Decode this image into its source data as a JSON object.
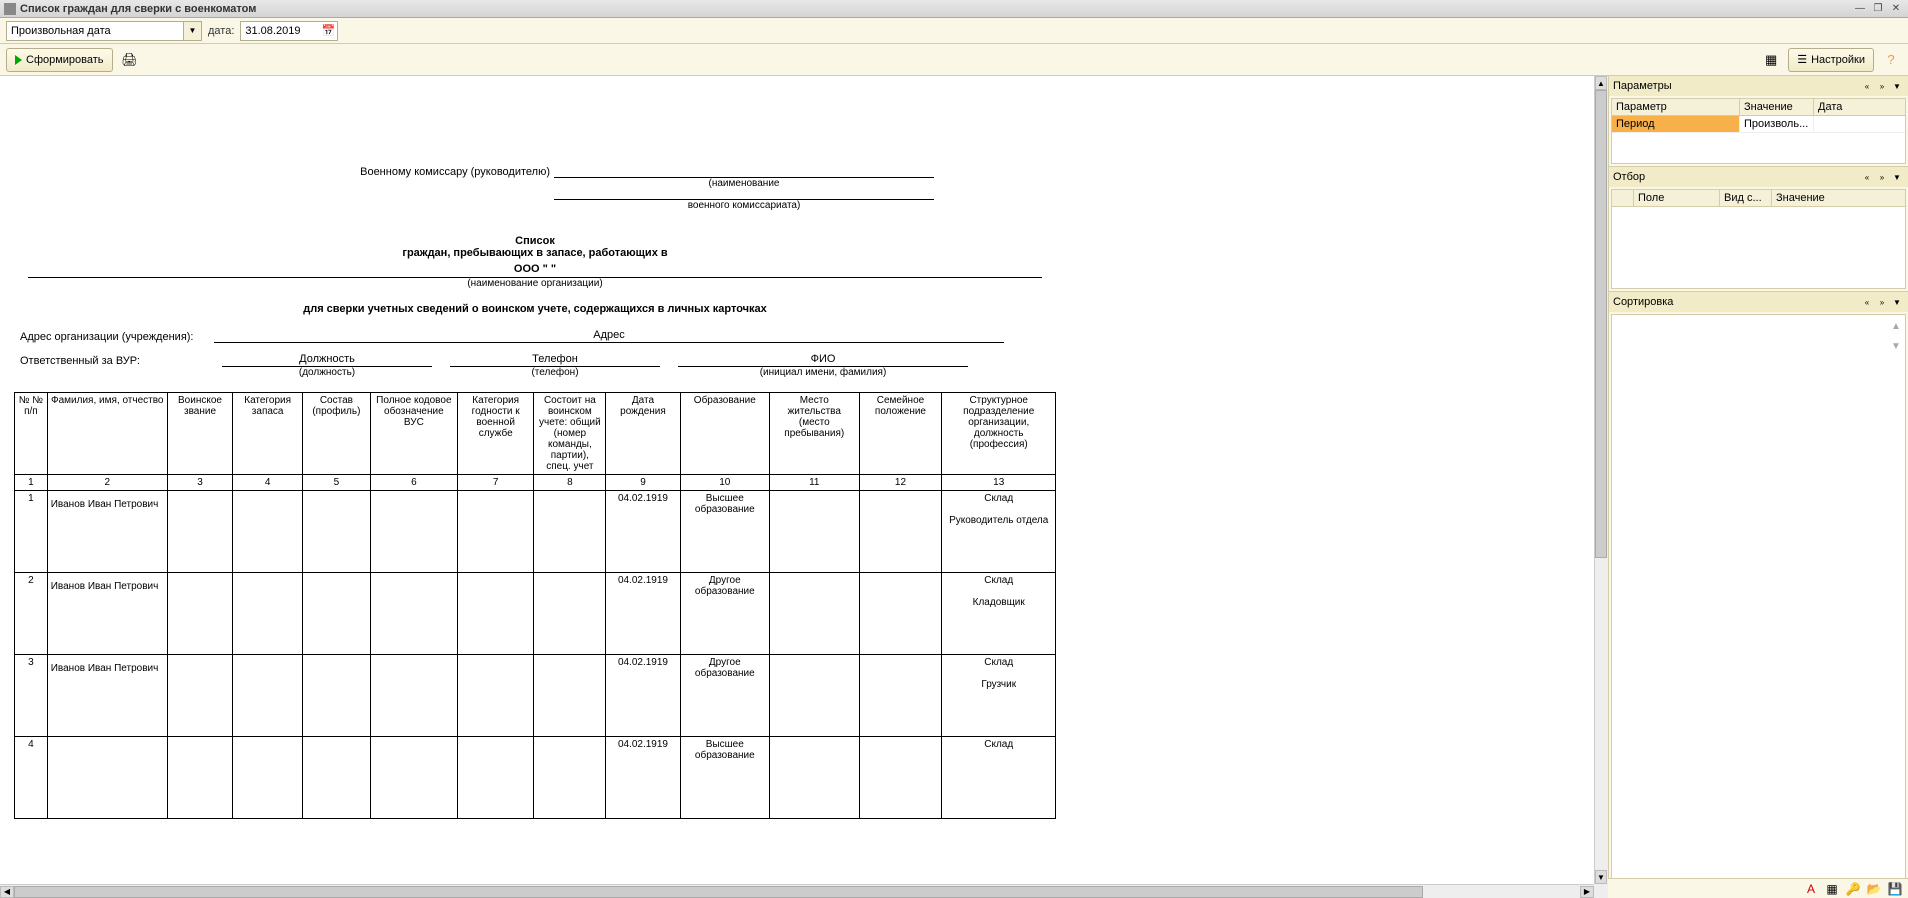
{
  "window": {
    "title": "Список граждан для сверки с военкоматом"
  },
  "filter": {
    "period_type": "Произвольная дата",
    "date_label": "дата:",
    "date_value": "31.08.2019"
  },
  "toolbar": {
    "generate": "Сформировать",
    "settings": "Настройки"
  },
  "report": {
    "to_commissar": "Военному комиссару (руководителю)",
    "sub1": "(наименование",
    "sub2": "военного комиссариата)",
    "title1": "Список",
    "title2": "граждан, пребывающих в запасе, работающих в",
    "org": "ООО \"           \"",
    "org_sub": "(наименование организации)",
    "subtitle": "для сверки учетных сведений о воинском учете, содержащихся в личных карточках",
    "addr_label": "Адрес организации (учреждения):",
    "addr_value": "Адрес",
    "resp_label": "Ответственный за ВУР:",
    "resp_cols": [
      {
        "value": "Должность",
        "sub": "(должность)"
      },
      {
        "value": "Телефон",
        "sub": "(телефон)"
      },
      {
        "value": "ФИО",
        "sub": "(инициал имени, фамилия)"
      }
    ],
    "headers": [
      "№ № п/п",
      "Фамилия, имя, отчество",
      "Воинское звание",
      "Категория запаса",
      "Состав (профиль)",
      "Полное кодовое обозначение ВУС",
      "Категория годности к военной службе",
      "Состоит на воинском учете: общий (номер команды, партии), спец. учет",
      "Дата рождения",
      "Образование",
      "Место жительства (место пребывания)",
      "Семейное положение",
      "Структурное подразделение организации, должность (профессия)"
    ],
    "col_nums": [
      "1",
      "2",
      "3",
      "4",
      "5",
      "6",
      "7",
      "8",
      "9",
      "10",
      "11",
      "12",
      "13"
    ],
    "rows": [
      {
        "n": "1",
        "name": "Иванов Иван Петрович",
        "dob": "04.02.1919",
        "edu": "Высшее образование",
        "dept": "Склад",
        "pos": "Руководитель отдела"
      },
      {
        "n": "2",
        "name": "Иванов Иван Петрович",
        "dob": "04.02.1919",
        "edu": "Другое образование",
        "dept": "Склад",
        "pos": "Кладовщик"
      },
      {
        "n": "3",
        "name": "Иванов Иван Петрович",
        "dob": "04.02.1919",
        "edu": "Другое образование",
        "dept": "Склад",
        "pos": "Грузчик"
      },
      {
        "n": "4",
        "name": "",
        "dob": "04.02.1919",
        "edu": "Высшее образование",
        "dept": "Склад",
        "pos": ""
      }
    ]
  },
  "side": {
    "params": {
      "title": "Параметры",
      "cols": [
        "Параметр",
        "Значение",
        "Дата"
      ],
      "rows": [
        {
          "param": "Период",
          "value": "Произволь...",
          "date": ""
        }
      ]
    },
    "filter": {
      "title": "Отбор",
      "cols": [
        "",
        "Поле",
        "Вид с...",
        "Значение"
      ]
    },
    "sort": {
      "title": "Сортировка"
    }
  }
}
